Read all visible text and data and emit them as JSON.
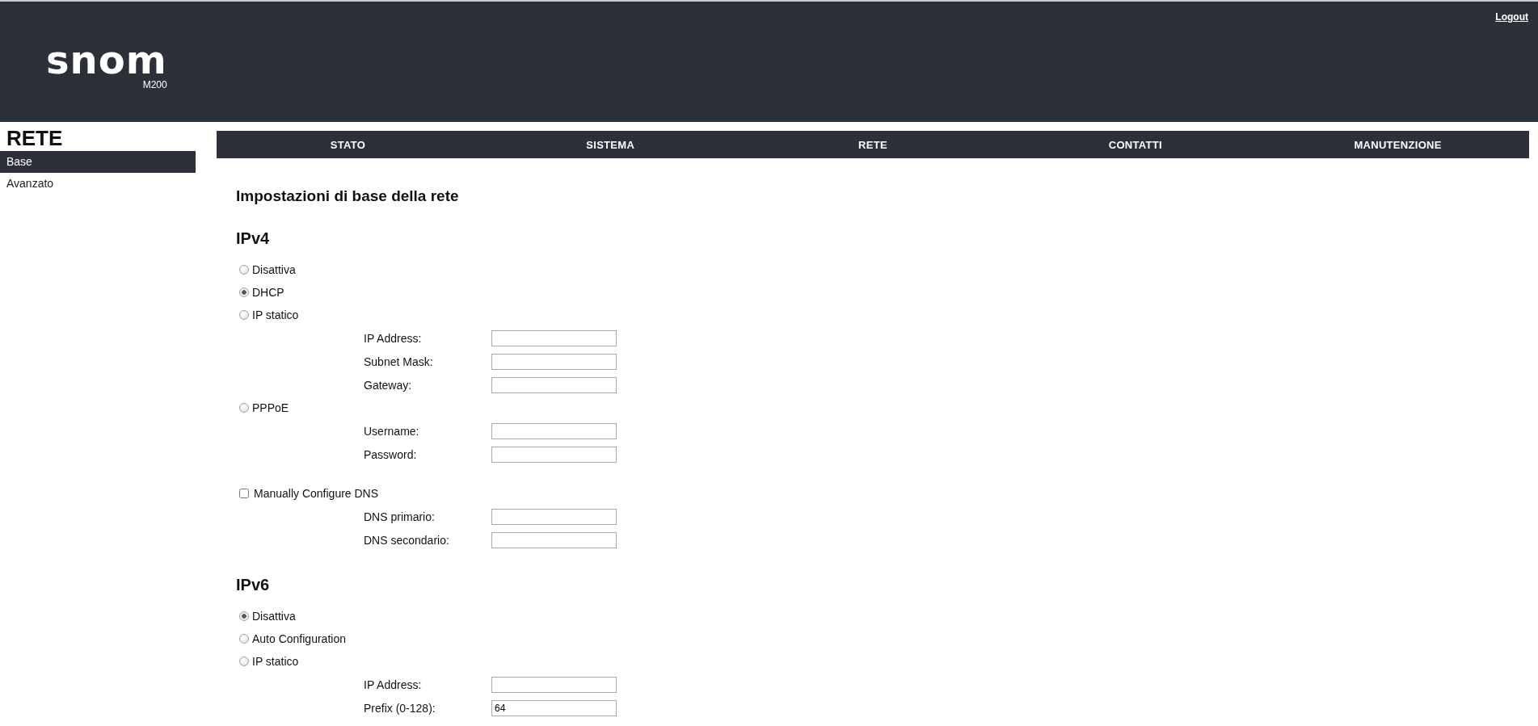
{
  "header": {
    "logo": "snom",
    "model": "M200",
    "logout": "Logout"
  },
  "sidebar": {
    "title": "RETE",
    "items": [
      {
        "label": "Base",
        "selected": true
      },
      {
        "label": "Avanzato",
        "selected": false
      }
    ]
  },
  "nav": [
    {
      "label": "STATO"
    },
    {
      "label": "SISTEMA"
    },
    {
      "label": "RETE"
    },
    {
      "label": "CONTATTI"
    },
    {
      "label": "MANUTENZIONE"
    }
  ],
  "page_title": "Impostazioni di base della rete",
  "ipv4": {
    "heading": "IPv4",
    "options": [
      {
        "label": "Disattiva",
        "selected": false
      },
      {
        "label": "DHCP",
        "selected": true
      },
      {
        "label": "IP statico",
        "selected": false,
        "fields": [
          {
            "label": "IP Address:"
          },
          {
            "label": "Subnet Mask:"
          },
          {
            "label": "Gateway:"
          }
        ]
      },
      {
        "label": "PPPoE",
        "selected": false,
        "fields": [
          {
            "label": "Username:"
          },
          {
            "label": "Password:"
          }
        ]
      }
    ],
    "dns": {
      "label": "Manually Configure DNS",
      "checked": false,
      "fields": [
        {
          "label": "DNS primario:"
        },
        {
          "label": "DNS secondario:"
        }
      ]
    }
  },
  "ipv6": {
    "heading": "IPv6",
    "options": [
      {
        "label": "Disattiva",
        "selected": true
      },
      {
        "label": "Auto Configuration",
        "selected": false
      },
      {
        "label": "IP statico",
        "selected": false,
        "fields": [
          {
            "label": "IP Address:"
          },
          {
            "label": "Prefix (0-128):",
            "value": "64"
          }
        ]
      }
    ]
  }
}
